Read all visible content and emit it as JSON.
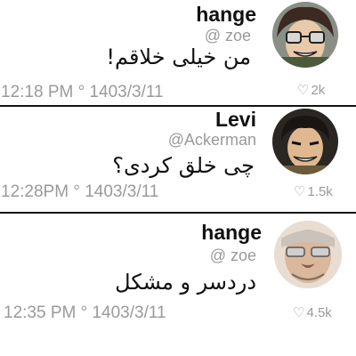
{
  "posts": [
    {
      "name": "hange",
      "handle": "@ zoe",
      "message": "من خیلی خلاقم!",
      "time": "12:18 PM ° 1403/3/11",
      "likes": "2k",
      "like_icon": "heart-outline-icon"
    },
    {
      "name": "Levi",
      "handle": "@Ackerman",
      "message": "چی خلق کردی؟",
      "time": "12:28PM ° 1403/3/11",
      "likes": "1.5k",
      "like_icon": "heart-outline-icon"
    },
    {
      "name": "hange",
      "handle": "@ zoe",
      "message": "دردسر و مشکل",
      "time": "12:35 PM ° 1403/3/11",
      "likes": "4.5k",
      "like_icon": "heart-outline-icon"
    }
  ],
  "colors": {
    "text": "#111111",
    "muted": "#9a9a9a",
    "divider": "#111111",
    "background": "#ffffff"
  }
}
